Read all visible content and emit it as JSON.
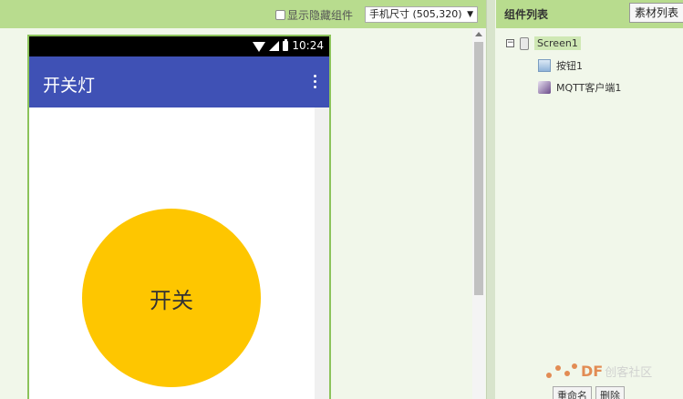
{
  "viewer": {
    "show_hidden_label": "显示隐藏组件",
    "size_select": "手机尺寸 (505,320)",
    "phone": {
      "time": "10:24",
      "app_title": "开关灯",
      "button_label": "开关"
    }
  },
  "components": {
    "title": "组件列表",
    "assets_button": "素材列表",
    "collapse_symbol": "⊟",
    "items": [
      {
        "label": "Screen1",
        "icon": "screen-icon"
      },
      {
        "label": "按钮1",
        "icon": "button-icon"
      },
      {
        "label": "MQTT客户端1",
        "icon": "mqtt-icon"
      }
    ],
    "rename_button": "重命名",
    "delete_button": "删除"
  },
  "watermark": {
    "brand": "DF",
    "text": "创客社区"
  },
  "colors": {
    "toolbar": "#b8dc8e",
    "app_bar": "#3f51b5",
    "button": "#fec600",
    "phone_border": "#8cc35b"
  }
}
